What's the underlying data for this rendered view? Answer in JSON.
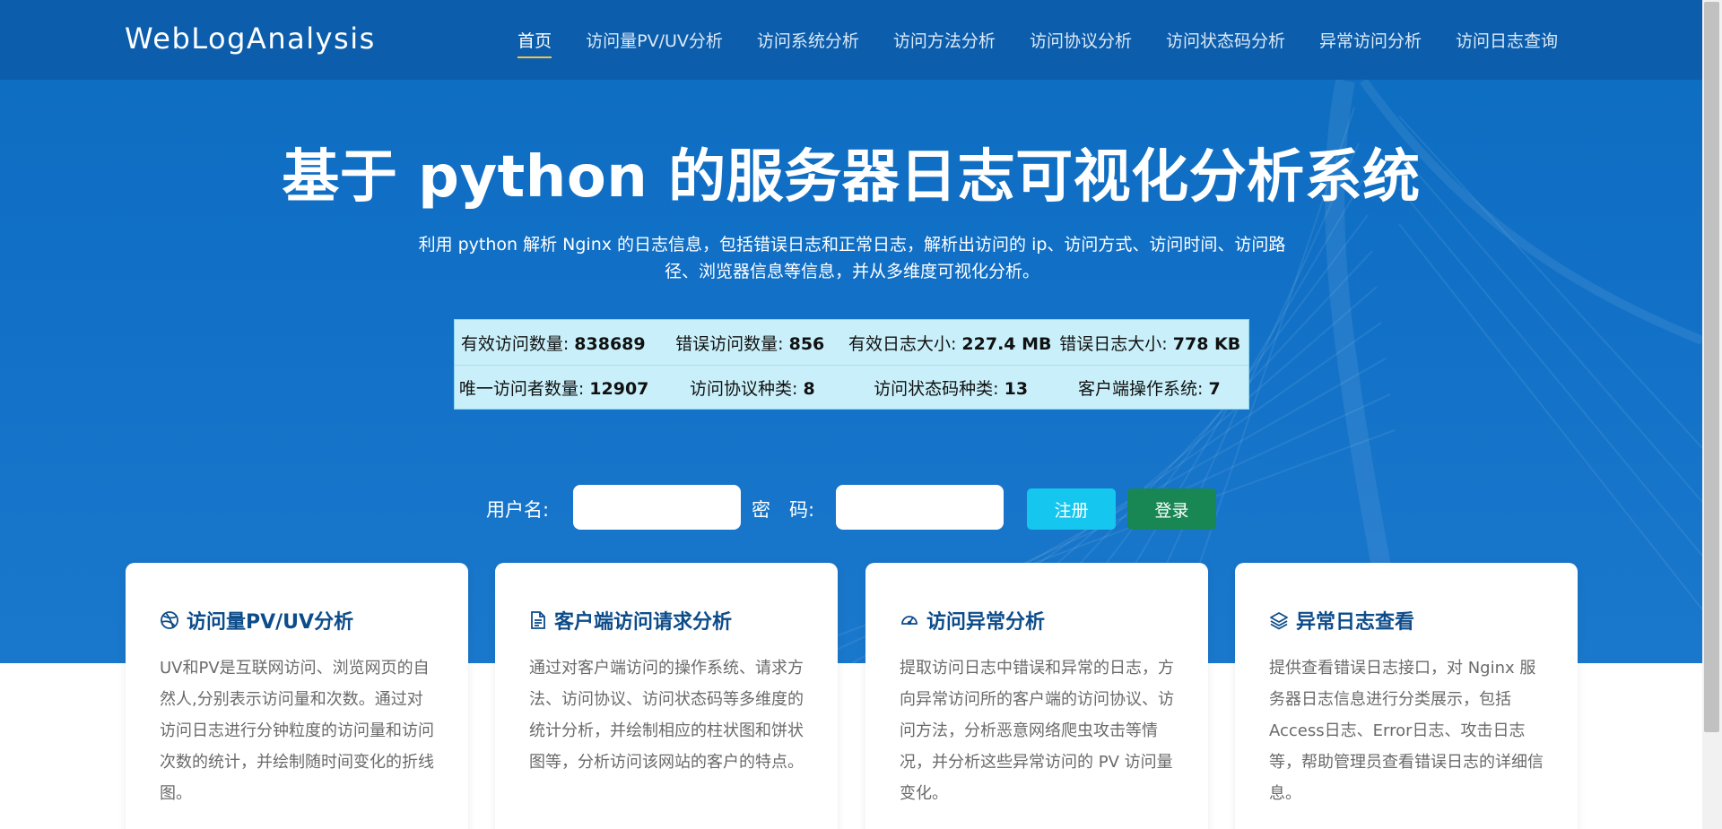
{
  "brand": "WebLogAnalysis",
  "nav": {
    "items": [
      {
        "label": "首页",
        "active": true
      },
      {
        "label": "访问量PV/UV分析"
      },
      {
        "label": "访问系统分析"
      },
      {
        "label": "访问方法分析"
      },
      {
        "label": "访问协议分析"
      },
      {
        "label": "访问状态码分析"
      },
      {
        "label": "异常访问分析"
      },
      {
        "label": "访问日志查询"
      }
    ]
  },
  "hero": {
    "title": "基于 python 的服务器日志可视化分析系统",
    "description": "利用 python 解析 Nginx 的日志信息，包括错误日志和正常日志，解析出访问的 ip、访问方式、访问时间、访问路径、浏览器信息等信息，并从多维度可视化分析。"
  },
  "stats": {
    "row1": [
      {
        "label": "有效访问数量: ",
        "value": "838689"
      },
      {
        "label": "错误访问数量: ",
        "value": "856"
      },
      {
        "label": "有效日志大小: ",
        "value": "227.4 MB"
      },
      {
        "label": "错误日志大小: ",
        "value": "778 KB"
      }
    ],
    "row2": [
      {
        "label": "唯一访问者数量: ",
        "value": "12907"
      },
      {
        "label": "访问协议种类: ",
        "value": "8"
      },
      {
        "label": "访问状态码种类: ",
        "value": "13"
      },
      {
        "label": "客户端操作系统: ",
        "value": "7"
      }
    ]
  },
  "login": {
    "username_label": "用户名:",
    "password_label": "密　码:",
    "username_value": "",
    "password_value": "",
    "register_label": "注册",
    "login_label": "登录"
  },
  "cards": [
    {
      "icon": "dribbble-icon",
      "title": "访问量PV/UV分析",
      "text": "UV和PV是互联网访问、浏览网页的自然人,分别表示访问量和次数。通过对访问日志进行分钟粒度的访问量和访问次数的统计，并绘制随时间变化的折线图。"
    },
    {
      "icon": "document-icon",
      "title": "客户端访问请求分析",
      "text": "通过对客户端访问的操作系统、请求方法、访问协议、访问状态码等多维度的统计分析，并绘制相应的柱状图和饼状图等，分析访问该网站的客户的特点。"
    },
    {
      "icon": "speedometer-icon",
      "title": "访问异常分析",
      "text": "提取访问日志中错误和异常的日志，方向异常访问所的客户端的访问协议、访问方法，分析恶意网络爬虫攻击等情况，并分析这些异常访问的 PV 访问量变化。"
    },
    {
      "icon": "layers-icon",
      "title": "异常日志查看",
      "text": "提供查看错误日志接口，对 Nginx 服务器日志信息进行分类展示，包括 Access日志、Error日志、攻击日志等，帮助管理员查看错误日志的详细信息。"
    }
  ]
}
